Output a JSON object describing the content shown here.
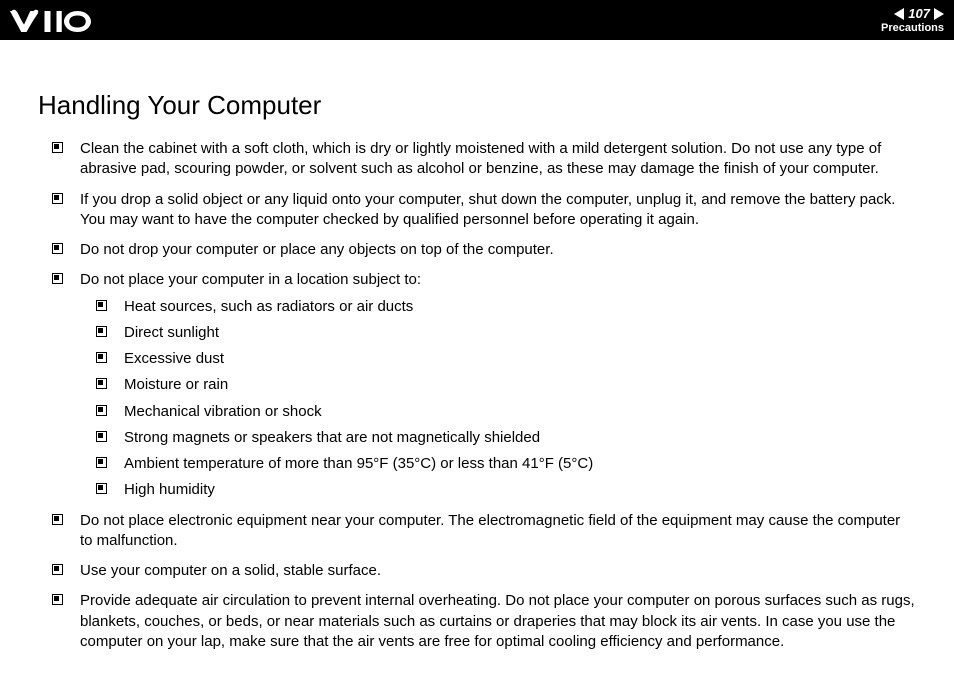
{
  "header": {
    "page_number": "107",
    "section": "Precautions"
  },
  "title": "Handling Your Computer",
  "items": [
    {
      "text": "Clean the cabinet with a soft cloth, which is dry or lightly moistened with a mild detergent solution. Do not use any type of abrasive pad, scouring powder, or solvent such as alcohol or benzine, as these may damage the finish of your computer."
    },
    {
      "text": "If you drop a solid object or any liquid onto your computer, shut down the computer, unplug it, and remove the battery pack. You may want to have the computer checked by qualified personnel before operating it again."
    },
    {
      "text": "Do not drop your computer or place any objects on top of the computer."
    },
    {
      "text": "Do not place your computer in a location subject to:",
      "sub": [
        "Heat sources, such as radiators or air ducts",
        "Direct sunlight",
        "Excessive dust",
        "Moisture or rain",
        "Mechanical vibration or shock",
        "Strong magnets or speakers that are not magnetically shielded",
        "Ambient temperature of more than 95°F (35°C) or less than 41°F (5°C)",
        "High humidity"
      ]
    },
    {
      "text": "Do not place electronic equipment near your computer. The electromagnetic field of the equipment may cause the computer to malfunction."
    },
    {
      "text": "Use your computer on a solid, stable surface."
    },
    {
      "text": "Provide adequate air circulation to prevent internal overheating. Do not place your computer on porous surfaces such as rugs, blankets, couches, or beds, or near materials such as curtains or draperies that may block its air vents. In case you use the computer on your lap, make sure that the air vents are free for optimal cooling efficiency and performance."
    }
  ]
}
